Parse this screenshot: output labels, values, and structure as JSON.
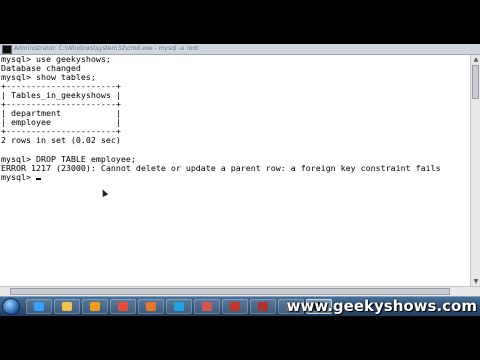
{
  "window": {
    "title": "Administrator: C:\\Windows\\system32\\cmd.exe - mysql -u root"
  },
  "console": {
    "lines": [
      "mysql> use geekyshows;",
      "Database changed",
      "mysql> show tables;",
      "+----------------------+",
      "| Tables_in_geekyshows |",
      "+----------------------+",
      "| department           |",
      "| employee             |",
      "+----------------------+",
      "2 rows in set (0.02 sec)",
      "",
      "mysql> DROP TABLE employee;",
      "ERROR 1217 (23000): Cannot delete or update a parent row: a foreign key constraint fails"
    ],
    "prompt": "mysql> "
  },
  "taskbar": {
    "icons": [
      "start-orb-icon",
      "ie-icon",
      "folder-icon",
      "media-player-icon",
      "chrome-icon",
      "firefox-icon",
      "skype-icon",
      "paint-icon",
      "pdf-icon",
      "acrobat-icon",
      "screen-recorder-icon",
      "cmd-icon"
    ],
    "colors": [
      "#3aa0ff",
      "#f2c14e",
      "#f39a1e",
      "#e84b3c",
      "#e8772e",
      "#1fa3e0",
      "#d9534f",
      "#c0392b",
      "#b03030",
      "#7a7a7a",
      "#111111"
    ]
  },
  "watermark": "www.geekyshows.com"
}
